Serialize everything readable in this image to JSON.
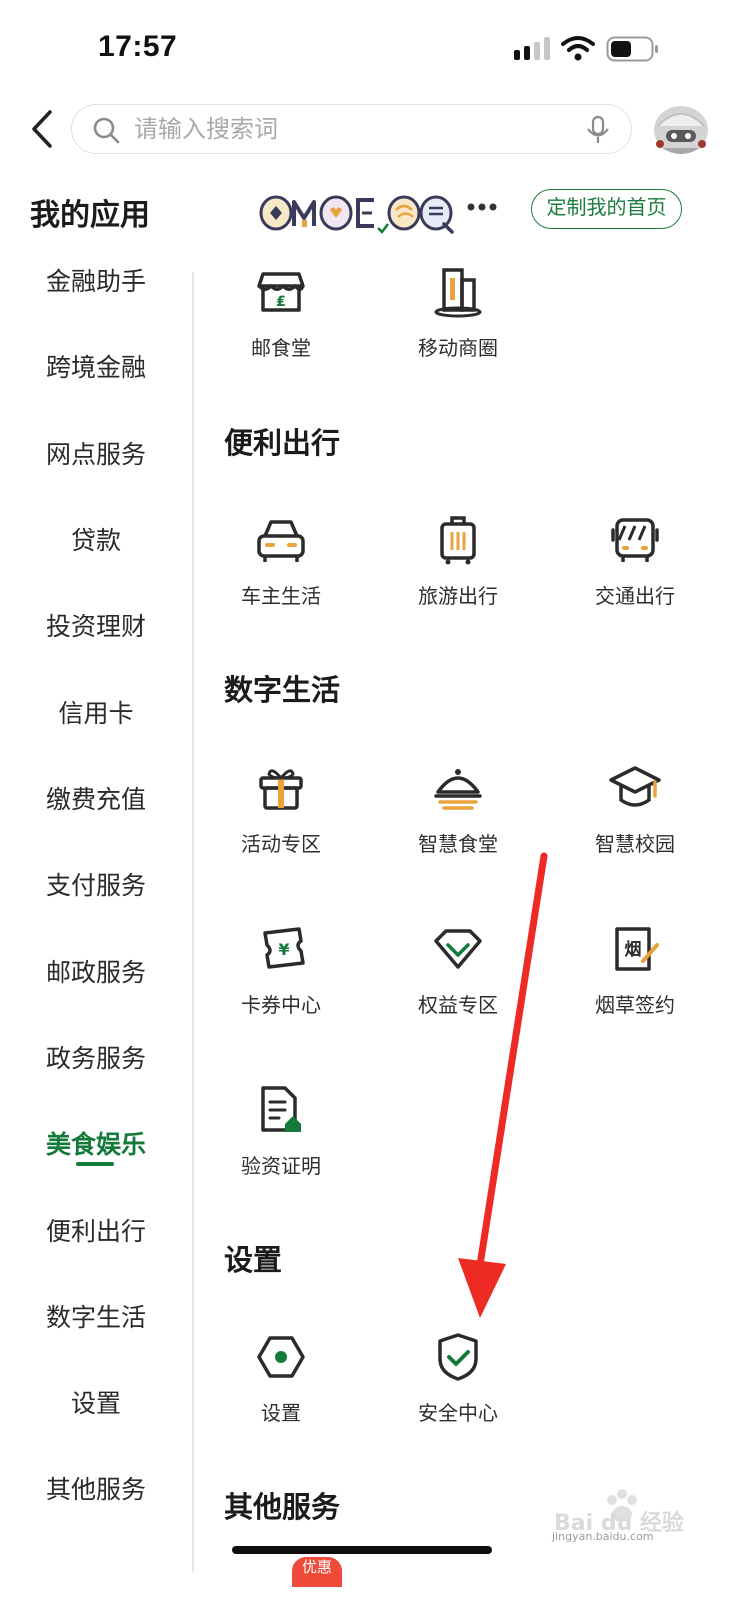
{
  "status_bar": {
    "time": "17:57"
  },
  "search": {
    "placeholder": "请输入搜索词"
  },
  "header": {
    "title": "我的应用",
    "customize_label": "定制我的首页"
  },
  "sidebar": {
    "items": [
      {
        "label": "金融助手"
      },
      {
        "label": "跨境金融"
      },
      {
        "label": "网点服务"
      },
      {
        "label": "贷款"
      },
      {
        "label": "投资理财"
      },
      {
        "label": "信用卡"
      },
      {
        "label": "缴费充值"
      },
      {
        "label": "支付服务"
      },
      {
        "label": "邮政服务"
      },
      {
        "label": "政务服务"
      },
      {
        "label": "美食娱乐",
        "active": true
      },
      {
        "label": "便利出行"
      },
      {
        "label": "数字生活"
      },
      {
        "label": "设置"
      },
      {
        "label": "其他服务"
      }
    ]
  },
  "content": {
    "food_apps": [
      {
        "label": "邮食堂",
        "icon": "store-icon"
      },
      {
        "label": "移动商圈",
        "icon": "building-icon"
      }
    ],
    "sections": [
      {
        "title": "便利出行",
        "apps": [
          {
            "label": "车主生活",
            "icon": "car-icon"
          },
          {
            "label": "旅游出行",
            "icon": "luggage-icon"
          },
          {
            "label": "交通出行",
            "icon": "bus-icon"
          }
        ]
      },
      {
        "title": "数字生活",
        "apps": [
          {
            "label": "活动专区",
            "icon": "gift-icon"
          },
          {
            "label": "智慧食堂",
            "icon": "dish-cover-icon"
          },
          {
            "label": "智慧校园",
            "icon": "graduation-cap-icon"
          },
          {
            "label": "卡券中心",
            "icon": "coupon-icon"
          },
          {
            "label": "权益专区",
            "icon": "diamond-icon"
          },
          {
            "label": "烟草签约",
            "icon": "tobacco-contract-icon",
            "icon_text": "烟"
          },
          {
            "label": "验资证明",
            "icon": "certificate-icon"
          }
        ]
      },
      {
        "title": "设置",
        "apps": [
          {
            "label": "设置",
            "icon": "settings-hexagon-icon"
          },
          {
            "label": "安全中心",
            "icon": "shield-check-icon"
          }
        ]
      },
      {
        "title": "其他服务"
      }
    ]
  },
  "promo_badge": "优惠",
  "watermark": {
    "brand": "Bai du 经验",
    "url": "jingyan.baidu.com"
  },
  "colors": {
    "brand_green": "#137a3a",
    "accent_orange": "#e8a33c",
    "icon_dark": "#2b2b2b",
    "annotation_red": "#ee2a24"
  }
}
